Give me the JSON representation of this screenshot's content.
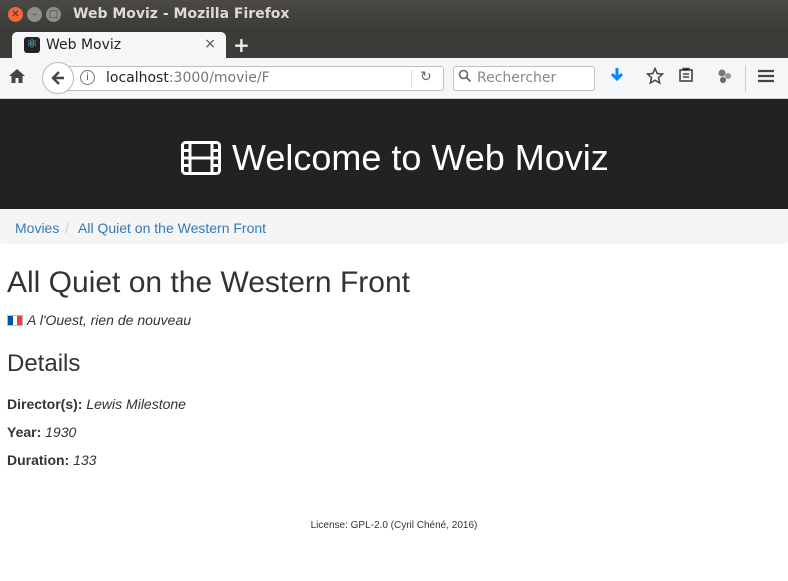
{
  "window": {
    "title": "Web Moviz - Mozilla Firefox"
  },
  "tab": {
    "label": "Web Moviz",
    "close_glyph": "×",
    "new_tab_glyph": "+"
  },
  "navbar": {
    "url_host": "localhost",
    "url_rest": ":3000/movie/F",
    "search_placeholder": "Rechercher"
  },
  "page": {
    "header_title": "Welcome to Web Moviz",
    "breadcrumb": {
      "home": "Movies",
      "current": "All Quiet on the Western Front"
    },
    "movie": {
      "title": "All Quiet on the Western Front",
      "original_title": "A l'Ouest, rien de nouveau",
      "flag_colors": [
        "#0055a4",
        "#ffffff",
        "#ef4135"
      ]
    },
    "details": {
      "heading": "Details",
      "director_label": "Director(s):",
      "director_value": "Lewis Milestone",
      "year_label": "Year:",
      "year_value": "1930",
      "duration_label": "Duration:",
      "duration_value": "133"
    },
    "footer": "License: GPL-2.0 (Cyril Chéné, 2016)"
  },
  "colors": {
    "header_bg": "#222222",
    "link": "#337ab7",
    "breadcrumb_bg": "#f5f5f5"
  }
}
